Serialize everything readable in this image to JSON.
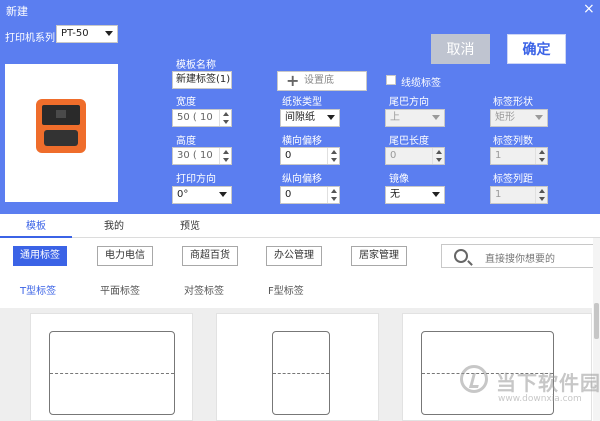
{
  "window": {
    "title": "新建",
    "close": "×"
  },
  "header": {
    "printer_series_label": "打印机系列",
    "printer_series_value": "PT-50",
    "cancel_label": "取消",
    "ok_label": "确定"
  },
  "form": {
    "template_name_label": "模板名称",
    "template_name_value": "新建标签(1)",
    "set_background_label": "设置底",
    "continuous_label_text": "线缆标签",
    "width_label": "宽度",
    "width_value": "50 ( 10",
    "paper_type_label": "纸张类型",
    "paper_type_value": "间隙纸",
    "tail_direction_label": "尾巴方向",
    "tail_direction_value": "上",
    "label_shape_label": "标签形状",
    "label_shape_value": "矩形",
    "height_label": "高度",
    "height_value": "30 ( 10",
    "horizontal_offset_label": "横向偏移",
    "horizontal_offset_value": "0",
    "tail_length_label": "尾巴长度",
    "tail_length_value": "0",
    "label_columns_label": "标签列数",
    "label_columns_value": "1",
    "print_direction_label": "打印方向",
    "print_direction_value": "0°",
    "vertical_offset_label": "纵向偏移",
    "vertical_offset_value": "0",
    "mirror_label": "镜像",
    "mirror_value": "无",
    "column_spacing_label": "标签列距",
    "column_spacing_value": "1"
  },
  "tabs": [
    {
      "label": "模板"
    },
    {
      "label": "我的"
    },
    {
      "label": "预览"
    }
  ],
  "categories": [
    {
      "label": "通用标签"
    },
    {
      "label": "电力电信"
    },
    {
      "label": "商超百货"
    },
    {
      "label": "办公管理"
    },
    {
      "label": "居家管理"
    }
  ],
  "search": {
    "placeholder": "直接搜你想要的"
  },
  "subtabs": [
    {
      "label": "T型标签"
    },
    {
      "label": "平面标签"
    },
    {
      "label": "对签标签"
    },
    {
      "label": "F型标签"
    }
  ],
  "watermark": {
    "cn": "当下软件园",
    "en": "www.downxia.com"
  },
  "colors": {
    "accent": "#3b63e6",
    "header_bg": "#5b7ef0",
    "device": "#ef6d2b"
  }
}
